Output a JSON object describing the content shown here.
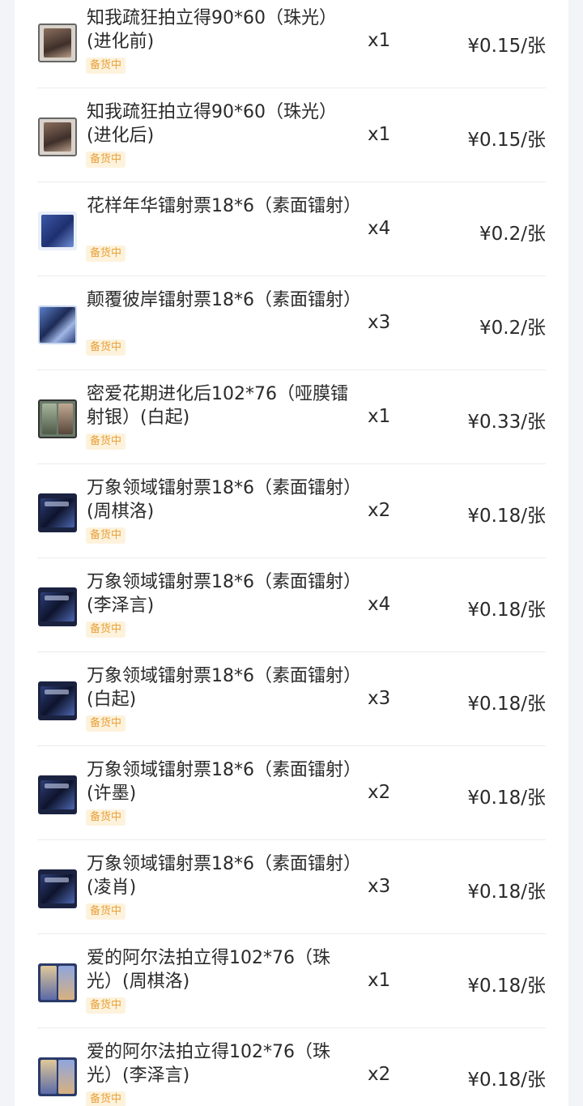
{
  "status_badge_label": "备货中",
  "colors": {
    "badge_text": "#e8a23a",
    "badge_bg": "#fdf2dc",
    "text": "#2a2a2a",
    "divider": "#ececec"
  },
  "items": [
    {
      "thumb": "portrait-photo-card",
      "title": "知我疏狂拍立得90*60（珠光）(进化前)",
      "qty": "x1",
      "price": "¥0.15/张"
    },
    {
      "thumb": "portrait-photo-card",
      "title": "知我疏狂拍立得90*60（珠光）(进化后)",
      "qty": "x1",
      "price": "¥0.15/张"
    },
    {
      "thumb": "blue-ticket",
      "title": "花样年华镭射票18*6（素面镭射）",
      "qty": "x4",
      "price": "¥0.2/张"
    },
    {
      "thumb": "art-card",
      "title": "颠覆彼岸镭射票18*6（素面镭射）",
      "qty": "x3",
      "price": "¥0.2/张"
    },
    {
      "thumb": "framed-photo-set",
      "title": "密爱花期进化后102*76（哑膜镭射银）(白起)",
      "qty": "x1",
      "price": "¥0.33/张"
    },
    {
      "thumb": "dark-ticket",
      "title": "万象领域镭射票18*6（素面镭射）(周棋洛)",
      "qty": "x2",
      "price": "¥0.18/张"
    },
    {
      "thumb": "dark-ticket",
      "title": "万象领域镭射票18*6（素面镭射）(李泽言)",
      "qty": "x4",
      "price": "¥0.18/张"
    },
    {
      "thumb": "dark-ticket",
      "title": "万象领域镭射票18*6（素面镭射）(白起)",
      "qty": "x3",
      "price": "¥0.18/张"
    },
    {
      "thumb": "dark-ticket",
      "title": "万象领域镭射票18*6（素面镭射）(许墨)",
      "qty": "x2",
      "price": "¥0.18/张"
    },
    {
      "thumb": "dark-ticket",
      "title": "万象领域镭射票18*6（素面镭射）(凌肖)",
      "qty": "x3",
      "price": "¥0.18/张"
    },
    {
      "thumb": "photo-grid",
      "title": "爱的阿尔法拍立得102*76（珠光）(周棋洛)",
      "qty": "x1",
      "price": "¥0.18/张"
    },
    {
      "thumb": "photo-grid",
      "title": "爱的阿尔法拍立得102*76（珠光）(李泽言)",
      "qty": "x2",
      "price": "¥0.18/张"
    }
  ]
}
